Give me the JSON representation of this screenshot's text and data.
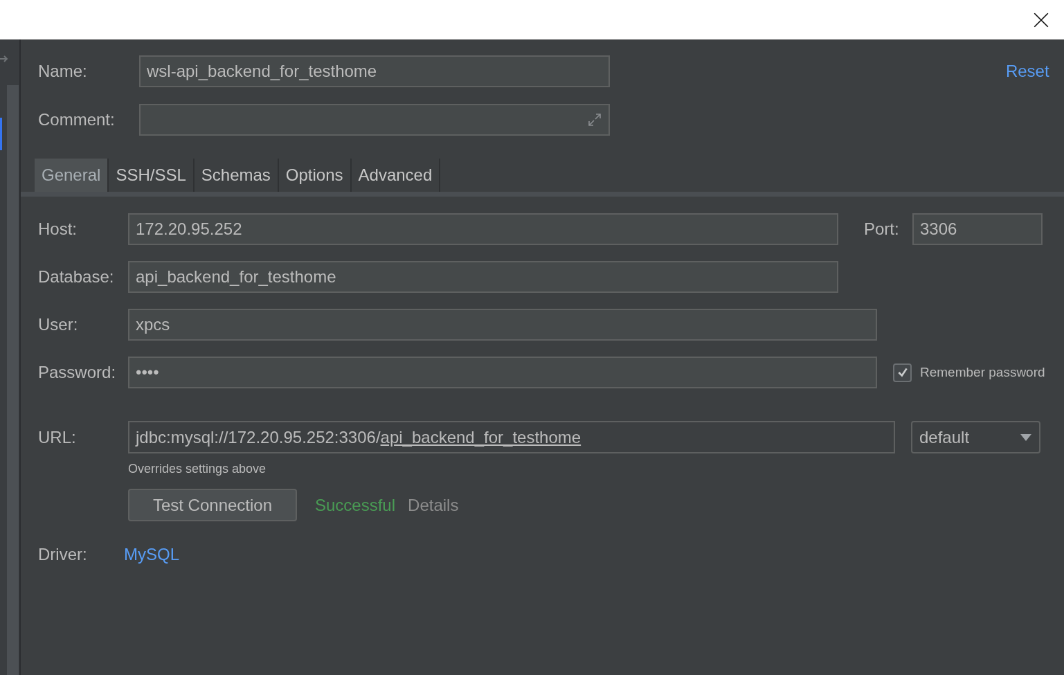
{
  "name": {
    "label": "Name:",
    "value": "wsl-api_backend_for_testhome"
  },
  "reset": "Reset",
  "comment": {
    "label": "Comment:"
  },
  "tabs": [
    {
      "label": "General",
      "selected": true
    },
    {
      "label": "SSH/SSL",
      "selected": false
    },
    {
      "label": "Schemas",
      "selected": false
    },
    {
      "label": "Options",
      "selected": false
    },
    {
      "label": "Advanced",
      "selected": false
    }
  ],
  "host": {
    "label": "Host:",
    "value": "172.20.95.252"
  },
  "port": {
    "label": "Port:",
    "value": "3306"
  },
  "database": {
    "label": "Database:",
    "value": "api_backend_for_testhome"
  },
  "user": {
    "label": "User:",
    "value": "xpcs"
  },
  "password": {
    "label": "Password:",
    "value": "••••"
  },
  "remember_password": {
    "label": "Remember password",
    "checked": true
  },
  "url": {
    "label": "URL:",
    "prefix": "jdbc:mysql://172.20.95.252:3306/",
    "link": "api_backend_for_testhome"
  },
  "url_mode": {
    "value": "default"
  },
  "url_hint": "Overrides settings above",
  "test_connection": {
    "label": "Test Connection"
  },
  "status": {
    "text": "Successful",
    "kind": "success"
  },
  "details": "Details",
  "driver": {
    "label": "Driver:",
    "value": "MySQL"
  }
}
